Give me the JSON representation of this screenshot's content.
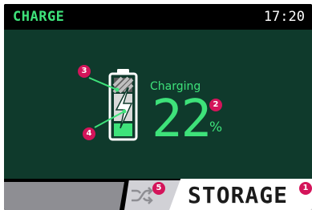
{
  "header": {
    "title": "CHARGE",
    "time": "17:20"
  },
  "status": {
    "charging_label": "Charging",
    "percent_value": "22",
    "percent_sign": "%",
    "battery_level": 0.22
  },
  "callouts": [
    "1",
    "2",
    "3",
    "4",
    "5"
  ],
  "bottom": {
    "active_label": "STORAGE"
  },
  "icons": {
    "battery": "battery-icon",
    "bolt": "lightning-bolt-icon",
    "swap": "swap-arrows-icon"
  },
  "colors": {
    "accent": "#3ee27a",
    "background": "#0f3a2c",
    "callout": "#d4145a"
  }
}
